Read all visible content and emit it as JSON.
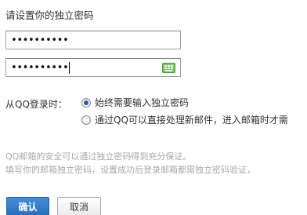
{
  "form": {
    "heading": "请设置你的独立密码",
    "password_value": "••••••••••",
    "confirm_password_value": "••••••••••",
    "keyboard_icon": "virtual-keyboard-icon",
    "keyboard_icon_color": "#7cc36a"
  },
  "login_option": {
    "label": "从QQ登录时：",
    "options": [
      {
        "label": "始终需要输入独立密码",
        "selected": true
      },
      {
        "label": "通过QQ可以直接处理新邮件，进入邮箱时才需",
        "selected": false
      }
    ]
  },
  "hints": {
    "line1": "QQ邮箱的安全可以通过独立密码得到充分保证。",
    "line2": "填写你的邮箱独立密码，设置成功后登录邮箱都需独立密码验证，"
  },
  "buttons": {
    "confirm": "确认",
    "cancel": "取消",
    "confirm_color": "#2f7dc9"
  }
}
